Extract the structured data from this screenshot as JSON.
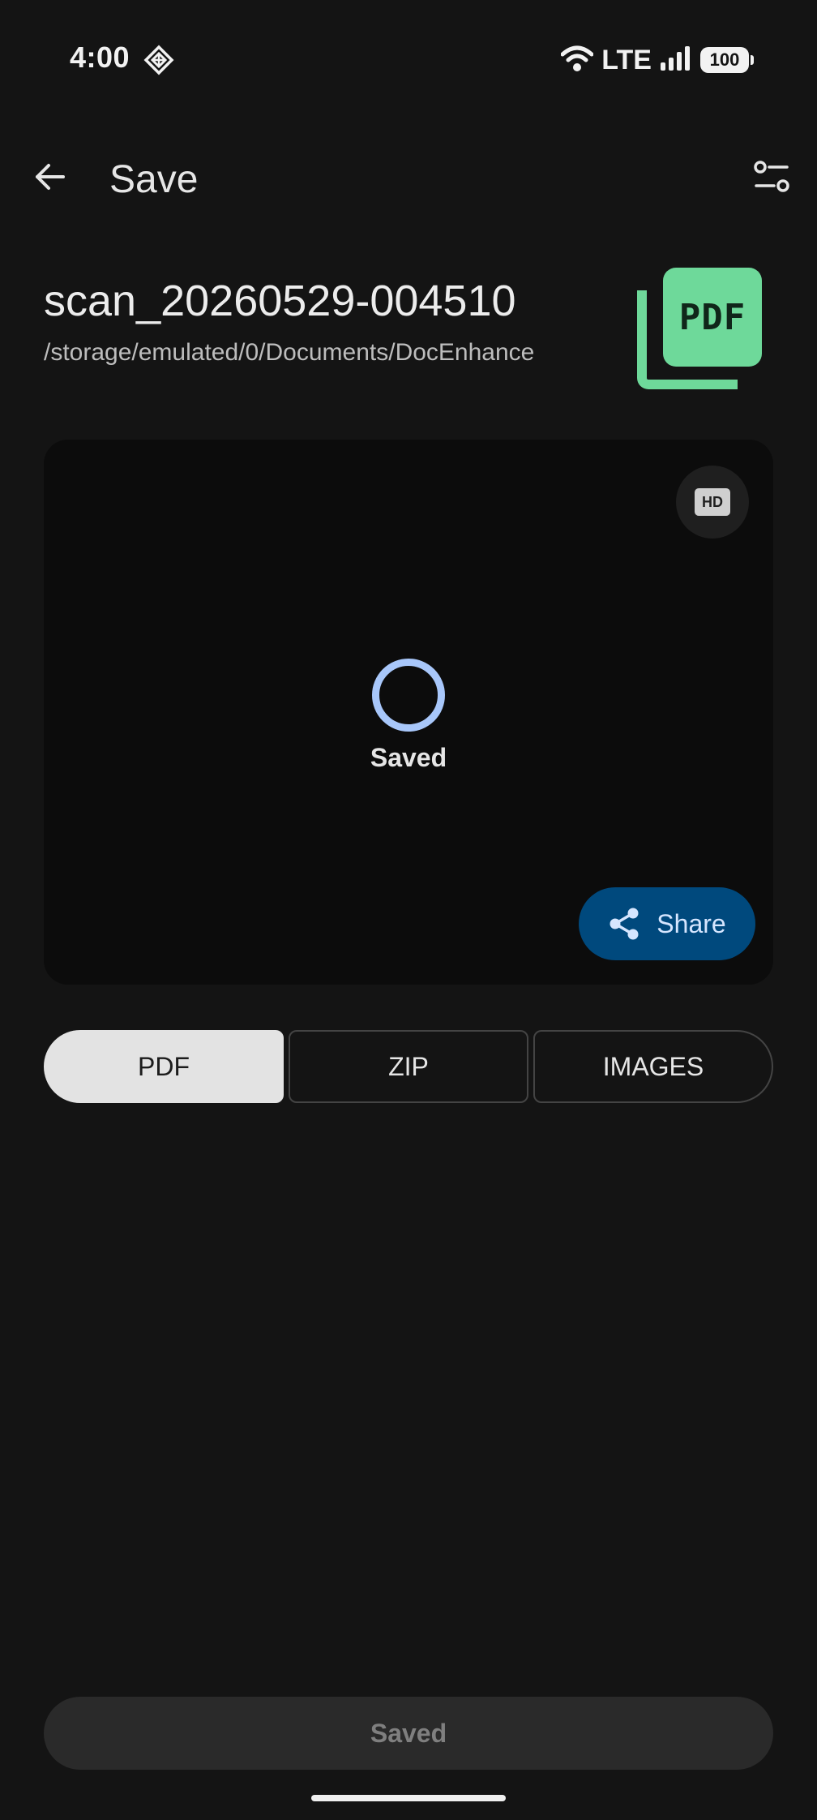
{
  "status_bar": {
    "time": "4:00",
    "network": "LTE",
    "battery": "100",
    "icons": [
      "assistant-icon",
      "wifi-icon",
      "signal-icon",
      "battery-icon"
    ]
  },
  "app_bar": {
    "title": "Save",
    "back_icon": "arrow-back-icon",
    "settings_icon": "tune-icon"
  },
  "file": {
    "name": "scan_20260529-004510",
    "path": "/storage/emulated/0/Documents/DocEnhance",
    "type_badge": "PDF"
  },
  "preview": {
    "hd_label": "HD",
    "status": "Saved",
    "share_label": "Share"
  },
  "formats": {
    "selected": "PDF",
    "options": [
      "PDF",
      "ZIP",
      "IMAGES"
    ]
  },
  "bottom": {
    "button_label": "Saved"
  },
  "colors": {
    "background": "#141414",
    "card": "#0c0c0c",
    "accent_green": "#6ed99a",
    "share_blue": "#00497d",
    "progress_blue": "#a8c7fa"
  }
}
